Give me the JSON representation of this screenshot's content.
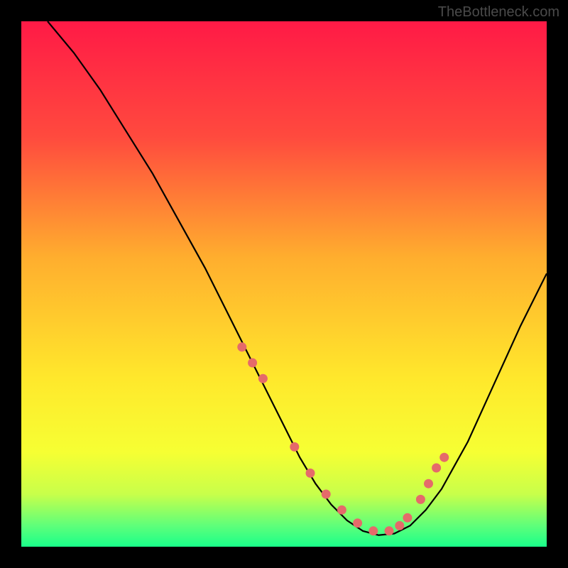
{
  "watermark": "TheBottleneck.com",
  "chart_data": {
    "type": "line",
    "title": "",
    "xlabel": "",
    "ylabel": "",
    "xlim": [
      0,
      100
    ],
    "ylim": [
      0,
      100
    ],
    "gradient_stops": [
      {
        "offset": 0,
        "color": "#ff1a46"
      },
      {
        "offset": 22,
        "color": "#ff4a3e"
      },
      {
        "offset": 45,
        "color": "#ffae2e"
      },
      {
        "offset": 68,
        "color": "#ffe82c"
      },
      {
        "offset": 82,
        "color": "#f6ff33"
      },
      {
        "offset": 90,
        "color": "#c8ff4a"
      },
      {
        "offset": 96,
        "color": "#5eff7a"
      },
      {
        "offset": 100,
        "color": "#1aff8a"
      }
    ],
    "curve": {
      "name": "bottleneck-curve",
      "x": [
        5,
        10,
        15,
        20,
        25,
        30,
        35,
        40,
        45,
        50,
        53,
        56,
        59,
        62,
        65,
        68,
        71,
        74,
        77,
        80,
        85,
        90,
        95,
        100
      ],
      "y": [
        100,
        94,
        87,
        79,
        71,
        62,
        53,
        43,
        33,
        23,
        17,
        12,
        8,
        5,
        3,
        2.2,
        2.5,
        4,
        7,
        11,
        20,
        31,
        42,
        52
      ]
    },
    "markers": {
      "name": "data-points",
      "color": "#e56a6a",
      "radius": 6.5,
      "x": [
        42,
        44,
        46,
        52,
        55,
        58,
        61,
        64,
        67,
        70,
        72,
        73.5,
        76,
        77.5,
        79,
        80.5
      ],
      "y": [
        38,
        35,
        32,
        19,
        14,
        10,
        7,
        4.5,
        3,
        3,
        4,
        5.5,
        9,
        12,
        15,
        17
      ]
    }
  }
}
